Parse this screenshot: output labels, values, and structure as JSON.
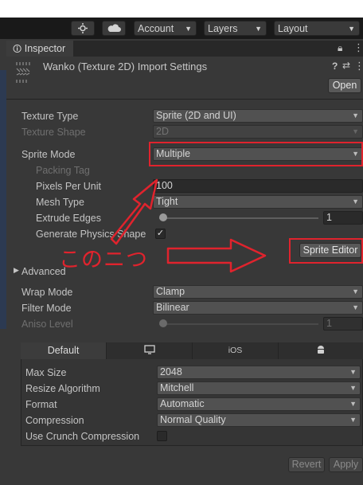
{
  "toolbar": {
    "account": "Account",
    "layers": "Layers",
    "layout": "Layout",
    "settings_icon": "collab-gear-icon",
    "cloud_icon": "cloud-icon"
  },
  "inspector_tab": {
    "title": "Inspector",
    "lock_icon": "lock-icon",
    "menu_icon": "kebab-menu-icon"
  },
  "asset": {
    "title": "Wanko (Texture 2D) Import Settings",
    "open_label": "Open"
  },
  "properties": {
    "texture_type": {
      "label": "Texture Type",
      "value": "Sprite (2D and UI)"
    },
    "texture_shape": {
      "label": "Texture Shape",
      "value": "2D"
    },
    "sprite_mode": {
      "label": "Sprite Mode",
      "value": "Multiple"
    },
    "packing_tag": {
      "label": "Packing Tag"
    },
    "pixels_per_unit": {
      "label": "Pixels Per Unit",
      "value": "100"
    },
    "mesh_type": {
      "label": "Mesh Type",
      "value": "Tight"
    },
    "extrude_edges": {
      "label": "Extrude Edges",
      "value": "1",
      "fraction": 0.0
    },
    "generate_physics_shape": {
      "label": "Generate Physics Shape",
      "checked": true,
      "mark": "✓"
    },
    "sprite_editor": "Sprite Editor",
    "advanced": "Advanced",
    "wrap_mode": {
      "label": "Wrap Mode",
      "value": "Clamp"
    },
    "filter_mode": {
      "label": "Filter Mode",
      "value": "Bilinear"
    },
    "aniso_level": {
      "label": "Aniso Level",
      "value": "1",
      "fraction": 0.0
    }
  },
  "platform": {
    "tabs": [
      "Default",
      "monitor-icon",
      "iOS",
      "android-icon"
    ],
    "max_size": {
      "label": "Max Size",
      "value": "2048"
    },
    "resize_algorithm": {
      "label": "Resize Algorithm",
      "value": "Mitchell"
    },
    "format": {
      "label": "Format",
      "value": "Automatic"
    },
    "compression": {
      "label": "Compression",
      "value": "Normal Quality"
    },
    "crunch": {
      "label": "Use Crunch Compression",
      "checked": false
    }
  },
  "footer": {
    "revert": "Revert",
    "apply": "Apply"
  },
  "annotation": {
    "text": "このニつ",
    "color": "#e0232d"
  }
}
